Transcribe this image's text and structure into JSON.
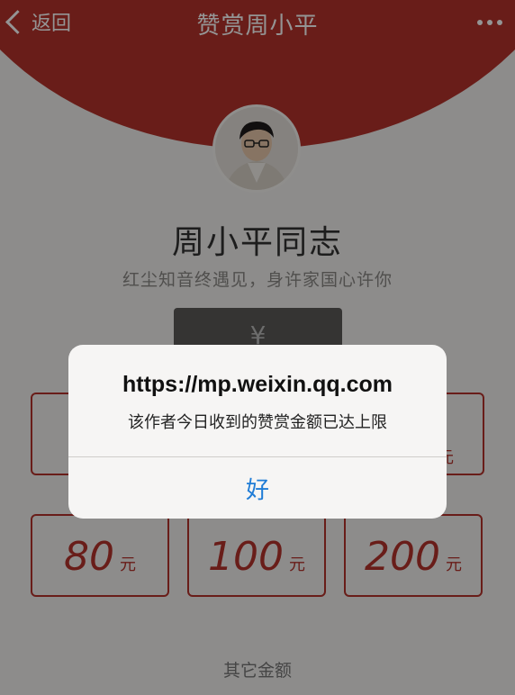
{
  "nav": {
    "back_label": "返回",
    "title": "赞赏周小平"
  },
  "profile": {
    "name": "周小平同志",
    "motto": "红尘知音终遇见，身许家国心许你"
  },
  "pay_button": {
    "symbol": "¥"
  },
  "amounts": [
    {
      "value": "80",
      "unit": "元"
    },
    {
      "value": "100",
      "unit": "元"
    },
    {
      "value": "200",
      "unit": "元"
    }
  ],
  "partial_amounts": {
    "right_unit": "元"
  },
  "other_amount_label": "其它金额",
  "alert": {
    "title": "https://mp.weixin.qq.com",
    "message": "该作者今日收到的赞赏金额已达上限",
    "ok_label": "好"
  },
  "colors": {
    "brand_red": "#b5332b",
    "link_blue": "#1f7cd6"
  }
}
